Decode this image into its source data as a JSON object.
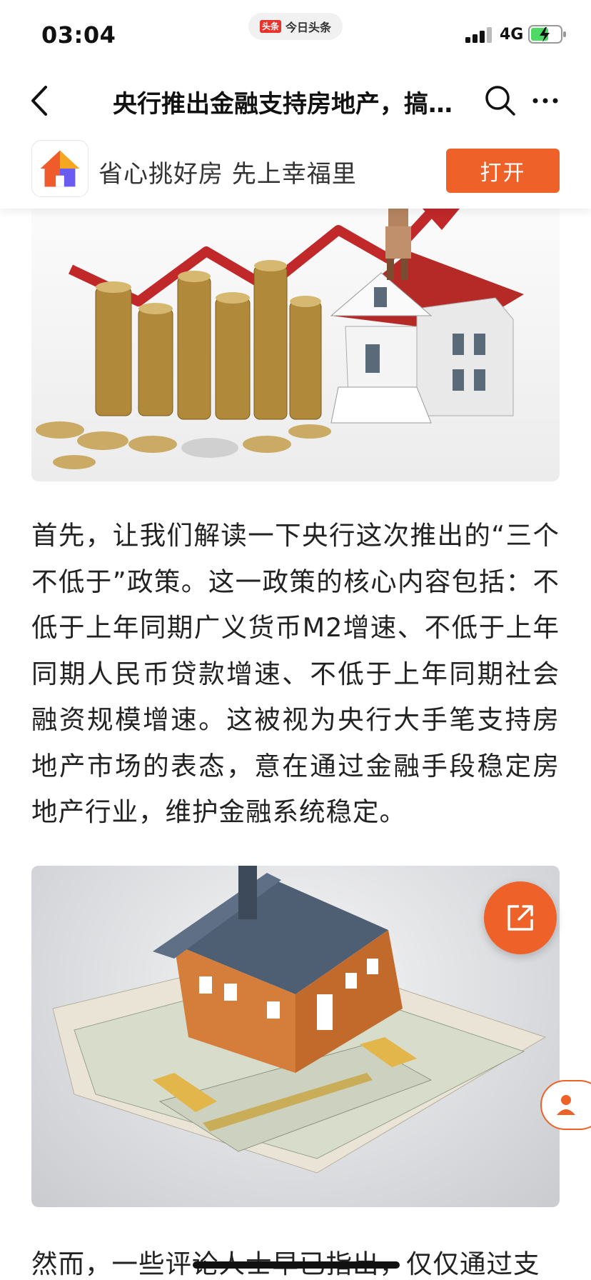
{
  "status_bar": {
    "time": "03:04",
    "app_pill_logo": "头条",
    "app_pill_name": "今日头条",
    "network": "4G"
  },
  "nav": {
    "title": "央行推出金融支持房地产，搞…"
  },
  "banner": {
    "text": "省心挑好房 先上幸福里",
    "open_label": "打开"
  },
  "article": {
    "paragraph1": "首先，让我们解读一下央行这次推出的“三个不低于”政策。这一政策的核心内容包括：不低于上年同期广义货币M2增速、不低于上年同期人民币贷款增速、不低于上年同期社会融资规模增速。这被视为央行大手笔支持房地产市场的表态，意在通过金融手段稳定房地产行业，维护金融系统稳定。",
    "paragraph2_partial": "然而，一些评论人士早已指出，仅仅通过支"
  },
  "colors": {
    "accent": "#ee6128",
    "text": "#222222",
    "background": "#ffffff"
  },
  "icons": [
    "back-icon",
    "search-icon",
    "more-icon",
    "app-house-icon",
    "share-icon",
    "person-icon",
    "signal-icon",
    "battery-icon"
  ]
}
